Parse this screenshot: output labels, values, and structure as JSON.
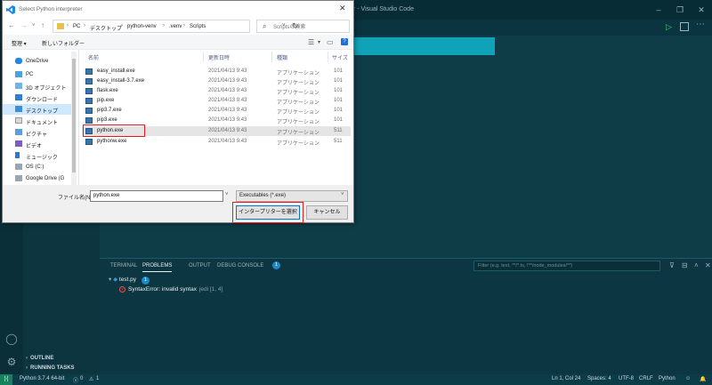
{
  "colors": {
    "vs_bg": "#0e3a45",
    "accent_green": "#16825d",
    "highlight_red": "#e81b1b",
    "selection_blue": "#cde8ff"
  },
  "vscode": {
    "title": "r - Visual Studio Code",
    "panel": {
      "tabs": [
        "TERMINAL",
        "PROBLEMS",
        "OUTPUT",
        "DEBUG CONSOLE"
      ],
      "problem_count": "1",
      "filter_placeholder": "Filter (e.g. text, **/*.ts, !**/node_modules/**)",
      "file": "test.py",
      "file_count": "1",
      "error_message": "SyntaxError: invalid syntax",
      "error_source": "jedi",
      "error_location": "[1, 4]"
    },
    "sidebar_sections": [
      "OUTLINE",
      "RUNNING TASKS"
    ],
    "status": {
      "interpreter": "Python 3.7.4 64-bit",
      "errors": "0",
      "warnings": "1",
      "position": "Ln 1, Col 24",
      "spaces": "Spaces: 4",
      "encoding": "UTF-8",
      "eol": "CRLF",
      "language": "Python"
    }
  },
  "dialog": {
    "title": "Select Python interpreter",
    "breadcrumbs": [
      "PC",
      "デスクトップ",
      "python-venv",
      ".venv",
      "Scripts"
    ],
    "search_placeholder": "Scriptsの検索",
    "organize": "整理 ▾",
    "new_folder": "新しいフォルダー",
    "nav_items": [
      {
        "label": "OneDrive",
        "icon": "cloud-icon"
      },
      {
        "label": "PC",
        "icon": "pc-icon"
      },
      {
        "label": "3D オブジェクト",
        "icon": "3d-objects-icon"
      },
      {
        "label": "ダウンロード",
        "icon": "download-icon"
      },
      {
        "label": "デスクトップ",
        "icon": "desktop-icon"
      },
      {
        "label": "ドキュメント",
        "icon": "documents-icon"
      },
      {
        "label": "ピクチャ",
        "icon": "pictures-icon"
      },
      {
        "label": "ビデオ",
        "icon": "video-icon"
      },
      {
        "label": "ミュージック",
        "icon": "music-icon"
      },
      {
        "label": "OS (C:)",
        "icon": "drive-icon"
      },
      {
        "label": "Google Drive (G",
        "icon": "google-drive-icon"
      }
    ],
    "columns": [
      "名前",
      "更新日時",
      "種類",
      "サイズ"
    ],
    "files": [
      {
        "name": "easy_install.exe",
        "date": "2021/04/13 9:43",
        "type": "アプリケーション",
        "size": "101"
      },
      {
        "name": "easy_install-3.7.exe",
        "date": "2021/04/13 9:43",
        "type": "アプリケーション",
        "size": "101"
      },
      {
        "name": "flask.exe",
        "date": "2021/04/13 9:43",
        "type": "アプリケーション",
        "size": "101"
      },
      {
        "name": "pip.exe",
        "date": "2021/04/13 9:43",
        "type": "アプリケーション",
        "size": "101"
      },
      {
        "name": "pip3.7.exe",
        "date": "2021/04/13 9:43",
        "type": "アプリケーション",
        "size": "101"
      },
      {
        "name": "pip3.exe",
        "date": "2021/04/13 9:43",
        "type": "アプリケーション",
        "size": "101"
      },
      {
        "name": "python.exe",
        "date": "2021/04/13 9:43",
        "type": "アプリケーション",
        "size": "511"
      },
      {
        "name": "pythonw.exe",
        "date": "2021/04/13 9:43",
        "type": "アプリケーション",
        "size": "511"
      }
    ],
    "filename_label": "ファイル名(N):",
    "filename_value": "python.exe",
    "filetype_value": "Executables (*.exe)",
    "ok_button": "インタープリターを選択",
    "cancel_button": "キャンセル"
  }
}
